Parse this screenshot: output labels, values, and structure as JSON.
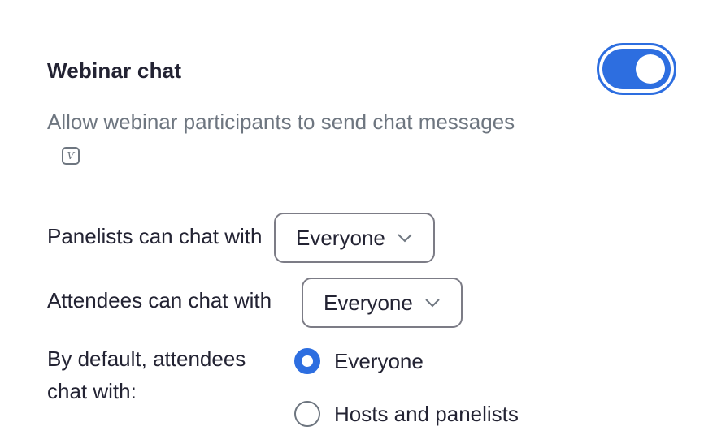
{
  "setting": {
    "title": "Webinar chat",
    "enabled": true,
    "description": "Allow webinar participants to send chat messages",
    "info_icon": "v-icon"
  },
  "panelists": {
    "label": "Panelists can chat with",
    "value": "Everyone"
  },
  "attendees": {
    "label": "Attendees can chat with",
    "value": "Everyone"
  },
  "default_chat": {
    "label_line1": "By default, attendees",
    "label_line2": "chat with:",
    "options": [
      {
        "label": "Everyone",
        "selected": true
      },
      {
        "label": "Hosts and panelists",
        "selected": false
      }
    ]
  },
  "colors": {
    "accent": "#2d6ee0",
    "text": "#232333",
    "muted": "#6e7680"
  }
}
